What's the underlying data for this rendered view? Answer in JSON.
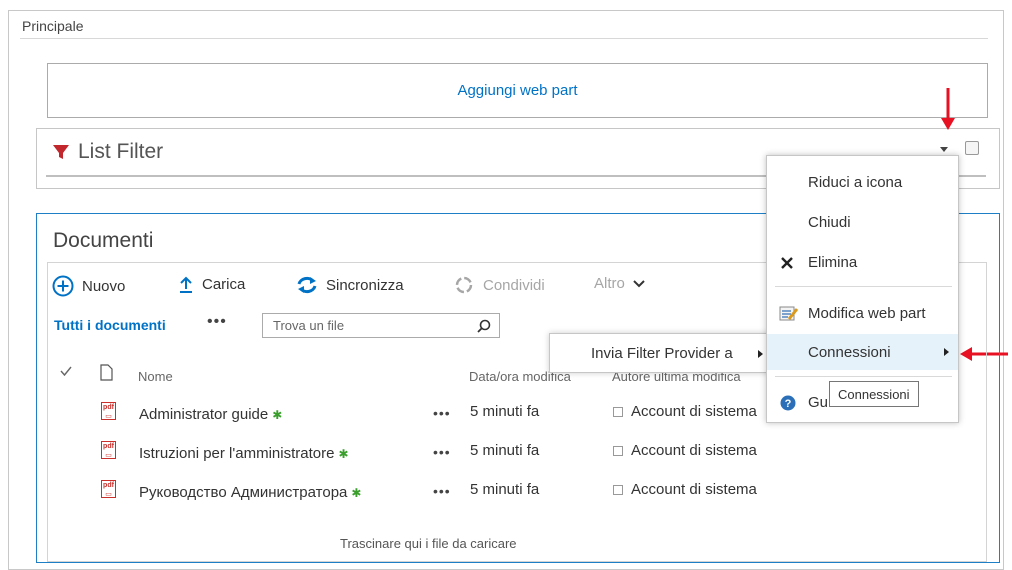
{
  "zone": {
    "title": "Principale"
  },
  "add_webpart": {
    "label": "Aggiungi web part"
  },
  "list_filter": {
    "title": "List Filter"
  },
  "documents": {
    "title": "Documenti",
    "commands": {
      "new": "Nuovo",
      "upload": "Carica",
      "sync": "Sincronizza",
      "share": "Condividi",
      "more": "Altro"
    },
    "view_all": "Tutti i documenti",
    "view_more": "•••",
    "search_placeholder": "Trova un file",
    "columns": {
      "name": "Nome",
      "modified": "Data/ora modifica",
      "author": "Autore ultima modifica"
    },
    "rows": [
      {
        "name": "Administrator guide",
        "new_mark": "✱",
        "more": "•••",
        "modified": "5 minuti fa",
        "author": "Account di sistema"
      },
      {
        "name": "Istruzioni per l'amministratore",
        "new_mark": "✱",
        "more": "•••",
        "modified": "5 minuti fa",
        "author": "Account di sistema"
      },
      {
        "name": "Руководство Администратора",
        "new_mark": "✱",
        "more": "•••",
        "modified": "5 minuti fa",
        "author": "Account di sistema"
      }
    ],
    "drop_hint": "Trascinare qui i file da caricare"
  },
  "context_menu": {
    "items": [
      {
        "label": "Riduci a icona"
      },
      {
        "label": "Chiudi"
      },
      {
        "label": "Elimina"
      },
      {
        "label": "Modifica web part"
      },
      {
        "label": "Connessioni"
      },
      {
        "label": "Gu"
      }
    ]
  },
  "submenu": {
    "label": "Invia Filter Provider a"
  },
  "tooltip": {
    "text": "Connessioni"
  },
  "colors": {
    "accent": "#0072c6",
    "annotation_red": "#e81123",
    "highlight": "#e6f2fa",
    "new_mark": "#3a9e2c"
  }
}
